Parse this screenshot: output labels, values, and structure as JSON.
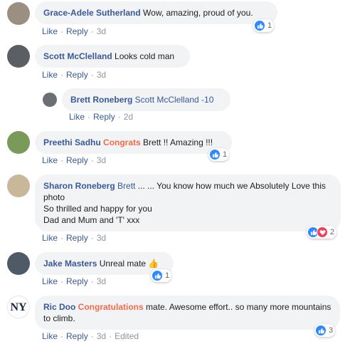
{
  "colors": {
    "name": "#385898",
    "tag": "#f06b4a",
    "bubble": "#f2f3f5",
    "like": "#2e89ff",
    "love": "#f33e58",
    "meta": "#90949c"
  },
  "actions": {
    "like": "Like",
    "reply": "Reply",
    "separator": "·"
  },
  "comments": [
    {
      "name": "Grace-Adele Sutherland",
      "tag": "",
      "text": " Wow, amazing, proud of you.",
      "time": "3d",
      "edited": "",
      "reactions": [
        "like"
      ],
      "reaction_count": "1"
    },
    {
      "name": "Scott McClelland",
      "tag": "",
      "text": " Looks cold man",
      "time": "3d",
      "edited": "",
      "reactions": [],
      "reaction_count": ""
    },
    {
      "name": "Brett Roneberg",
      "tag": "",
      "text": " Scott McClelland -10",
      "time": "2d",
      "edited": "",
      "reactions": [],
      "reaction_count": ""
    },
    {
      "name": "Preethi Sadhu",
      "tag": " Congrats",
      "text": " Brett !! Amazing !!!",
      "time": "3d",
      "edited": "",
      "reactions": [
        "like"
      ],
      "reaction_count": "1"
    },
    {
      "name": "Sharon Roneberg",
      "tag": " Brett",
      "text": " ... ... You know how much we Absolutely Love this photo",
      "lines": [
        "So thrilled and happy for you",
        "Dad and Mum and 'T' xxx"
      ],
      "time": "3d",
      "edited": "",
      "reactions": [
        "like",
        "love"
      ],
      "reaction_count": "2"
    },
    {
      "name": "Jake Masters",
      "tag": "",
      "text": " Unreal mate 👍",
      "time": "3d",
      "edited": "",
      "reactions": [
        "like"
      ],
      "reaction_count": "1"
    },
    {
      "name": "Ric Doo",
      "tag": " Congratulations",
      "text": " mate. Awesome effort.. so many more mountains to climb.",
      "time": "3d",
      "edited": "Edited",
      "reactions": [
        "like"
      ],
      "reaction_count": "3"
    }
  ]
}
